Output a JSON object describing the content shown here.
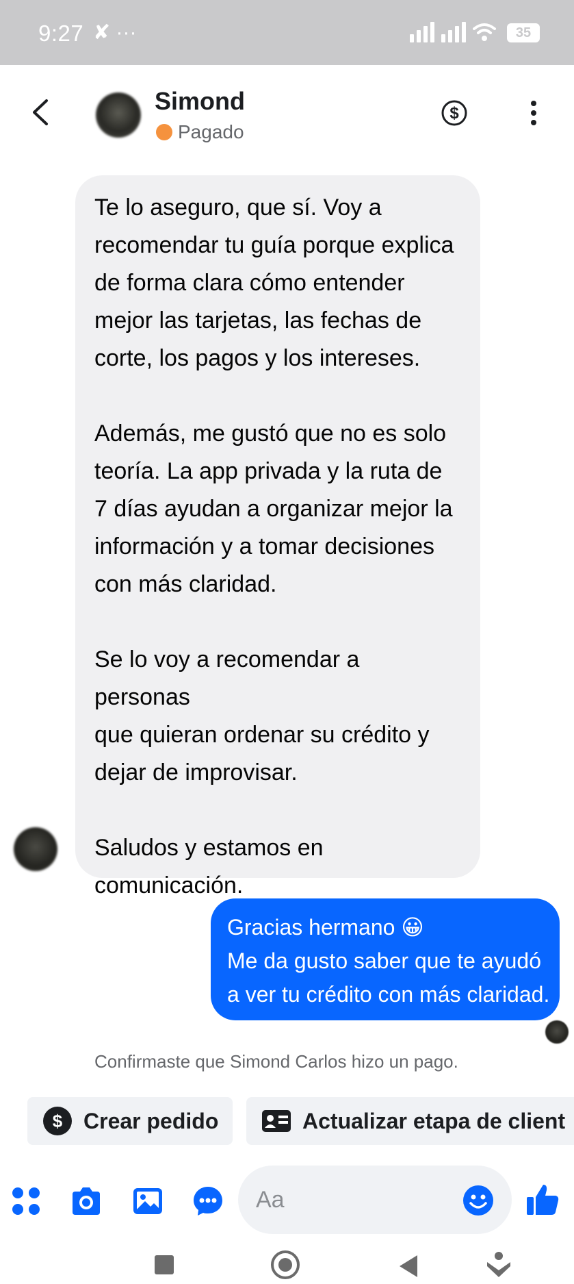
{
  "status_bar": {
    "time": "9:27",
    "left_icons": "✘ ···",
    "battery": "35",
    "icons": [
      "signal-icon",
      "signal-icon",
      "wifi-icon",
      "battery-icon"
    ]
  },
  "header": {
    "contact_name": "Simond",
    "status_label": "Pagado",
    "status_color": "#f5923e",
    "icons": [
      "back-arrow-icon",
      "avatar",
      "dollar-circle-icon",
      "more-vertical-icon"
    ]
  },
  "conversation": {
    "incoming": {
      "paragraphs": [
        "Te lo aseguro, que sí. Voy a\nrecomendar tu guía porque explica\nde forma clara cómo entender\nmejor las tarjetas, las fechas de\ncorte, los pagos y los intereses.",
        "Además, me gustó que no es solo\nteoría. La app privada y la ruta de\n7 días ayudan a organizar mejor la\ninformación y a tomar decisiones\ncon más claridad.",
        "Se lo voy a recomendar a personas\nque quieran ordenar su crédito y\ndejar de improvisar.",
        "Saludos y estamos en\ncomunicación."
      ]
    },
    "outgoing": {
      "lines": [
        "Gracias hermano 😀",
        "Me da gusto saber que te ayudó",
        "a ver tu crédito con más claridad."
      ],
      "bubble_color": "#0866ff"
    },
    "system_note": "Confirmaste que Simond Carlos hizo un pago."
  },
  "quick_actions": [
    {
      "label": "Crear pedido",
      "icon": "dollar-circle-icon"
    },
    {
      "label": "Actualizar etapa de client",
      "icon": "contact-card-icon"
    }
  ],
  "composer": {
    "placeholder": "Aa",
    "tools": [
      "apps-grid-icon",
      "camera-icon",
      "gallery-icon",
      "chat-bubble-icon"
    ],
    "emoji_icon": "smiley-icon",
    "send_icon": "thumbs-up-icon",
    "accent_color": "#0866ff"
  },
  "nav_bar": {
    "icons": [
      "recent-apps-icon",
      "home-icon",
      "back-icon",
      "assistant-icon"
    ]
  }
}
